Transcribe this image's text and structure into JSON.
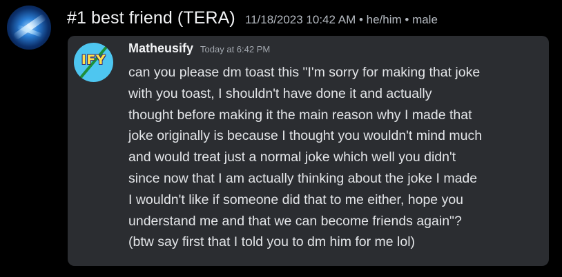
{
  "header": {
    "display_name": "#1 best friend (TERA)",
    "meta": "11/18/2023 10:42 AM • he/him • male"
  },
  "quote": {
    "author": "Matheusify",
    "avatar_text": "IFY",
    "timestamp": "Today at 6:42 PM",
    "lines": [
      "can you please dm toast this \"I'm sorry for making that joke",
      "with you toast, I shouldn't have done it and actually",
      "thought before making it the main reason why I made that",
      "joke originally is because I thought you wouldn't mind much",
      "and would treat just a normal joke which well you didn't",
      "since now that I am actually thinking about the joke I made",
      "I wouldn't like if someone did that to me either, hope you",
      "understand me and that we can become friends again\"?",
      "(btw say first that I told you to dm him for me lol)"
    ]
  },
  "colors": {
    "background": "#000000",
    "card": "#2b2d31",
    "text": "#e3e5e8",
    "muted": "#b5bac1"
  }
}
